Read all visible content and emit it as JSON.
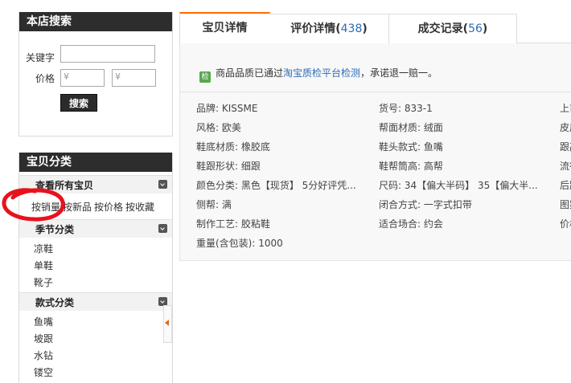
{
  "store_search": {
    "title": "本店搜索",
    "keyword_label": "关键字",
    "keyword_value": "",
    "price_label": "价格",
    "price_min_placeholder": "¥",
    "price_max_placeholder": "¥",
    "search_button": "搜索"
  },
  "categories": {
    "title": "宝贝分类",
    "view_all": "查看所有宝贝",
    "sort_options": [
      "按销量",
      "按新品",
      "按价格",
      "按收藏"
    ],
    "groups": [
      {
        "name": "季节分类",
        "items": [
          "凉鞋",
          "单鞋",
          "靴子"
        ]
      },
      {
        "name": "款式分类",
        "items": [
          "鱼嘴",
          "坡跟",
          "水钻",
          "镂空"
        ]
      }
    ]
  },
  "tabs": [
    {
      "label": "宝贝详情",
      "count": ""
    },
    {
      "label": "评价详情",
      "count": "438"
    },
    {
      "label": "成交记录",
      "count": "56"
    }
  ],
  "quality": {
    "icon": "检",
    "text_before": "商品品质已通过",
    "link": "淘宝质检平台检测",
    "text_after": "，承诺退一赔一。"
  },
  "attributes": {
    "col1": [
      "品牌: KISSME",
      "风格: 欧美",
      "鞋底材质: 橡胶底",
      "鞋跟形状: 细跟",
      "颜色分类: 黑色【现货】 5分好评凭...",
      "侧帮: 满",
      "制作工艺: 胶粘鞋",
      "重量(含包装): 1000"
    ],
    "col2": [
      "货号: 833-1",
      "帮面材质: 绒面",
      "鞋头款式: 鱼嘴",
      "鞋帮筒高: 高帮",
      "尺码: 34【偏大半码】 35【偏大半...",
      "闭合方式: 一字式扣带",
      "适合场合: 约会"
    ],
    "col3": [
      "上市",
      "皮质",
      "跟高",
      "流行",
      "后跟",
      "图案",
      "价格"
    ]
  },
  "colors": {
    "accent": "#ff6a00",
    "link": "#2e6cb5",
    "header_bg": "#2d2d2d",
    "annotation": "#e8121b"
  }
}
